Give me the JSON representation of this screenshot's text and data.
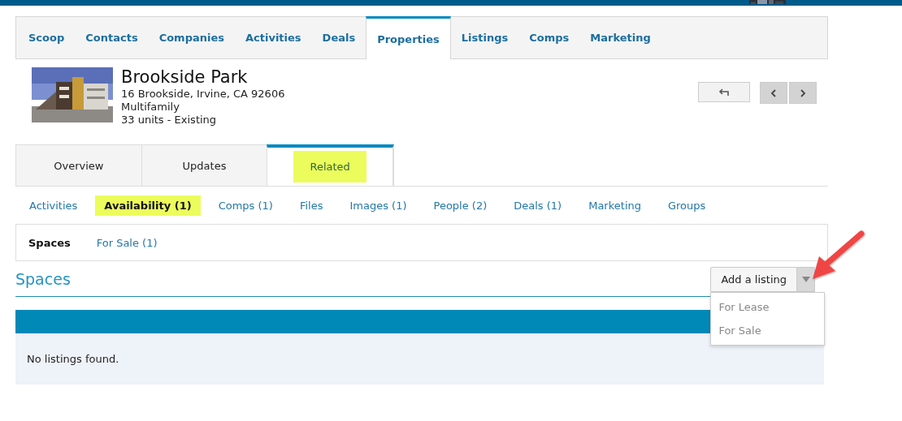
{
  "main_nav": [
    {
      "label": "Scoop",
      "selected": false
    },
    {
      "label": "Contacts",
      "selected": false
    },
    {
      "label": "Companies",
      "selected": false
    },
    {
      "label": "Activities",
      "selected": false
    },
    {
      "label": "Deals",
      "selected": false
    },
    {
      "label": "Properties",
      "selected": true
    },
    {
      "label": "Listings",
      "selected": false
    },
    {
      "label": "Comps",
      "selected": false
    },
    {
      "label": "Marketing",
      "selected": false
    }
  ],
  "property": {
    "name": "Brookside Park",
    "address": "16 Brookside, Irvine, CA 92606",
    "type": "Multifamily",
    "units": "33 units - Existing"
  },
  "detail_tabs": [
    {
      "label": "Overview",
      "selected": false,
      "highlighted": false
    },
    {
      "label": "Updates",
      "selected": false,
      "highlighted": false
    },
    {
      "label": "Related",
      "selected": true,
      "highlighted": true
    }
  ],
  "related_tabs": [
    {
      "label": "Activities",
      "selected": false,
      "highlighted": false
    },
    {
      "label": "Availability (1)",
      "selected": true,
      "highlighted": true
    },
    {
      "label": "Comps (1)",
      "selected": false,
      "highlighted": false
    },
    {
      "label": "Files",
      "selected": false,
      "highlighted": false
    },
    {
      "label": "Images (1)",
      "selected": false,
      "highlighted": false
    },
    {
      "label": "People (2)",
      "selected": false,
      "highlighted": false
    },
    {
      "label": "Deals (1)",
      "selected": false,
      "highlighted": false
    },
    {
      "label": "Marketing",
      "selected": false,
      "highlighted": false
    },
    {
      "label": "Groups",
      "selected": false,
      "highlighted": false
    }
  ],
  "space_tabs": [
    {
      "label": "Spaces",
      "selected": true
    },
    {
      "label": "For Sale (1)",
      "selected": false
    }
  ],
  "section_title": "Spaces",
  "add_button": {
    "label": "Add a listing",
    "expanded": true
  },
  "dropdown_options": [
    "For Lease",
    "For Sale"
  ],
  "empty_message": "No listings found."
}
